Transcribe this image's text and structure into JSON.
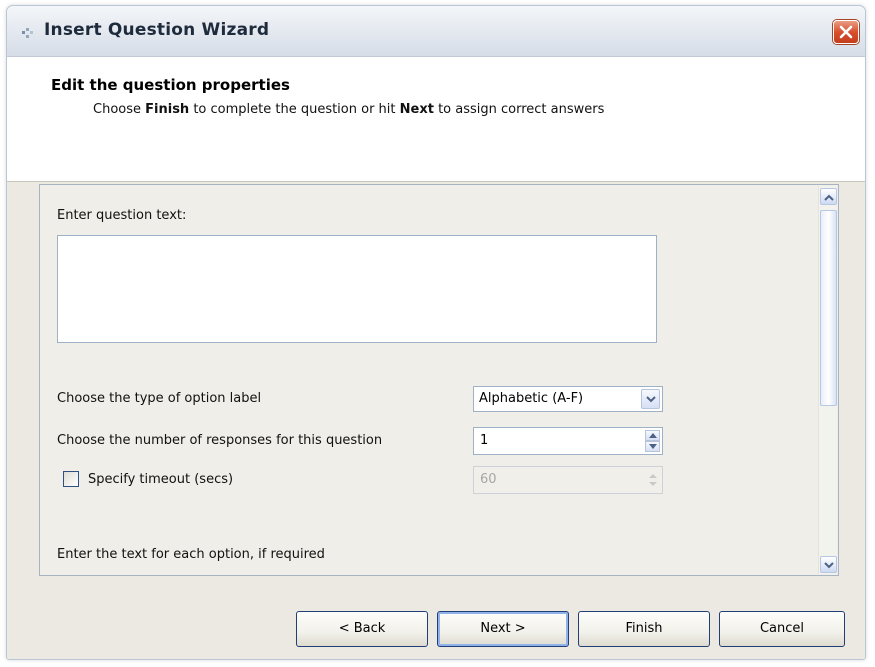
{
  "window": {
    "title": "Insert Question Wizard",
    "app_icon": "wizard-icon",
    "close_icon": "close-icon"
  },
  "header": {
    "title": "Edit the question properties",
    "subtitle_parts": {
      "p1": "Choose ",
      "b1": "Finish",
      "p2": " to complete the question or hit ",
      "b2": "Next",
      "p3": " to assign correct answers"
    }
  },
  "form": {
    "question_text_label": "Enter question text:",
    "question_text_value": "",
    "option_label_type_label": "Choose the type of option label",
    "option_label_type_value": "Alphabetic (A-F)",
    "responses_label": "Choose the number of responses for this question",
    "responses_value": "1",
    "timeout_checkbox_label": "Specify timeout (secs)",
    "timeout_checked": false,
    "timeout_value": "60",
    "option_text_label": "Enter the text for each option, if required"
  },
  "buttons": {
    "back": "< Back",
    "next": "Next >",
    "finish": "Finish",
    "cancel": "Cancel"
  },
  "colors": {
    "close_button": "#d8502e",
    "button_border": "#223f75",
    "panel_bg": "#efeee9"
  }
}
